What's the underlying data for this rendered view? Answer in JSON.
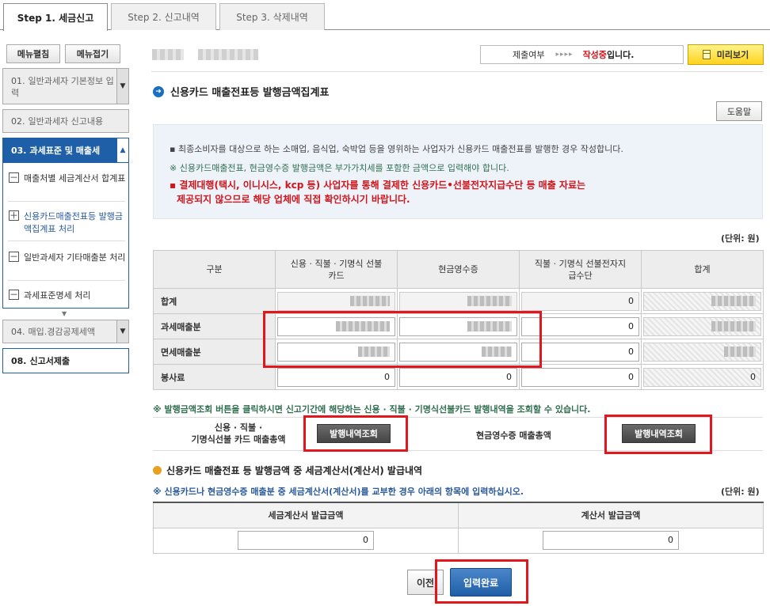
{
  "tabs": [
    "Step 1. 세금신고",
    "Step 2. 신고내역",
    "Step 3. 삭제내역"
  ],
  "sidebar": {
    "expand_label": "메뉴펼침",
    "collapse_label": "메뉴접기",
    "items": [
      {
        "num": "01.",
        "label": "일반과세자 기본정보 입력"
      },
      {
        "num": "02.",
        "label": "일반과세자 신고내용"
      },
      {
        "num": "03.",
        "label": "과세표준 및 매출세"
      },
      {
        "num": "04.",
        "label": "매입.경감공제세액"
      },
      {
        "num": "08.",
        "label": "신고서제출"
      }
    ],
    "sub_items": [
      {
        "box": "－",
        "label": "매출처별 세금계산서 합계표"
      },
      {
        "box": "＋",
        "label": "신용카드매출전표등 발행금액집계표 처리"
      },
      {
        "box": "－",
        "label": "일반과세자 기타매출분 처리"
      },
      {
        "box": "－",
        "label": "과세표준명세 처리"
      }
    ]
  },
  "status": {
    "label": "제출여부",
    "arrows": "▸▸▸▸",
    "value": "작성중",
    "suffix": "입니다.",
    "preview_label": "미리보기"
  },
  "section_title": "신용카드 매출전표등 발행금액집계표",
  "help_label": "도움말",
  "notice": {
    "line1": "최종소비자를 대상으로 하는 소매업, 음식업, 숙박업 등을 영위하는 사업자가 신용카드 매출전표를 발행한 경우 작성합니다.",
    "line2": "※ 신용카드매출전표, 현금영수증 발행금액은 부가가치세를 포함한 금액으로 입력해야 합니다.",
    "line3": "결제대행(택시, 이니시스, kcp 등) 사업자를 통해 결제한 신용카드•선불전자지급수단 등 매출 자료는",
    "line4": "제공되지 않으므로 해당 업체에 직접 확인하시기 바랍니다."
  },
  "unit_label": "(단위: 원)",
  "table": {
    "headers": [
      "구분",
      "신용 · 직불 · 기명식 선불카드",
      "현금영수증",
      "직불 · 기명식 선불전자지급수단",
      "합계"
    ],
    "rows": [
      {
        "label": "합계",
        "values": [
          "",
          "",
          "0",
          ""
        ]
      },
      {
        "label": "과세매출분",
        "values": [
          "",
          "",
          "0",
          ""
        ]
      },
      {
        "label": "면세매출분",
        "values": [
          "",
          "",
          "0",
          ""
        ]
      },
      {
        "label": "봉사료",
        "values": [
          "0",
          "0",
          "0",
          "0"
        ]
      }
    ]
  },
  "query_note": "※ 발행금액조회 버튼을 클릭하시면 신고기간에 해당하는 신용 · 직불 · 기명식선불카드 발행내역을 조회할 수 있습니다.",
  "query": {
    "card_label_1": "신용 · 직불 ·",
    "card_label_2": "기명식선불 카드 매출총액",
    "card_button": "발행내역조회",
    "cash_label": "현금영수증 매출총액",
    "cash_button": "발행내역조회"
  },
  "tax_invoice": {
    "title": "신용카드 매출전표 등 발행금액 중 세금계산서(계산서) 발급내역",
    "note": "※ 신용카드나 현금영수증 매출분 중 세금계산서(계산서)를 교부한 경우 아래의 항목에 입력하십시오.",
    "unit": "(단위: 원)",
    "headers": [
      "세금계산서 발급금액",
      "계산서 발급금액"
    ],
    "values": [
      "0",
      "0"
    ]
  },
  "footer": {
    "prev_label": "이전",
    "done_label": "입력완료"
  },
  "colors": {
    "accent_blue": "#1f5fa8",
    "warning_red": "#d0161c",
    "highlight_red": "#e2161c",
    "preview_yellow": "#ffd21f"
  }
}
